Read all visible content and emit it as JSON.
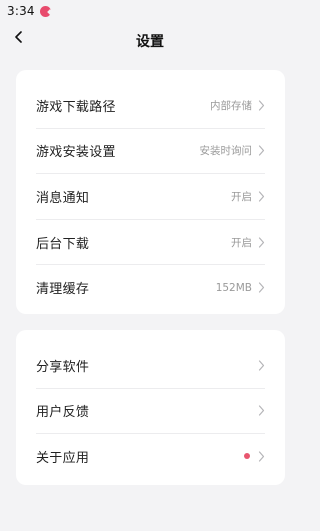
{
  "status_bar": {
    "time": "3:34",
    "app_icon": "pacman-icon"
  },
  "header": {
    "back_icon": "chevron-left-icon",
    "title": "设置"
  },
  "settings_group": {
    "items": [
      {
        "label": "游戏下载路径",
        "value": "内部存储"
      },
      {
        "label": "游戏安装设置",
        "value": "安装时询问"
      },
      {
        "label": "消息通知",
        "value": "开启"
      },
      {
        "label": "后台下载",
        "value": "开启"
      },
      {
        "label": "清理缓存",
        "value": "152MB"
      }
    ]
  },
  "about_group": {
    "items": [
      {
        "label": "分享软件"
      },
      {
        "label": "用户反馈"
      },
      {
        "label": "关于应用",
        "badge": "red-dot"
      }
    ]
  },
  "colors": {
    "background": "#f3f3f5",
    "card": "#ffffff",
    "badge": "#e8566f",
    "secondary_text": "#9a9a9a"
  }
}
